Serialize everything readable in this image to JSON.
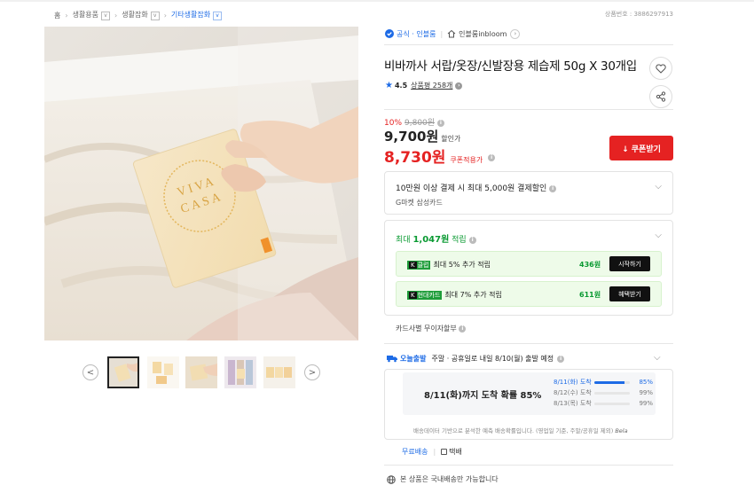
{
  "breadcrumb": {
    "home": "홈",
    "level1": "생활용품",
    "level2": "생활잡화",
    "level3": "기타생활잡화",
    "dropdown_glyph": "v"
  },
  "product_number": "상품번호 : 3886297913",
  "gallery": {
    "image_text_line1": "VIVA",
    "image_text_line2": "CASA",
    "prev_label": "<",
    "next_label": ">"
  },
  "brand": {
    "official_label": "공식 · 인블룸",
    "store_label": "인블룸inbloom"
  },
  "title": "비바까사 서랍/옷장/신발장용 제습제 50g X 30개입",
  "rating": {
    "score": "4.5",
    "review_label": "상품평 258개"
  },
  "price": {
    "discount_rate": "10%",
    "original": "9,800원",
    "sale": "9,700원",
    "sale_suffix": "할인가",
    "coupon_price": "8,730원",
    "coupon_suffix": "쿠폰적용가",
    "coupon_button": "↓ 쿠폰받기"
  },
  "card_promo": {
    "title": "10만원 이상 결제 시 최대 5,000원 결제할인",
    "subtitle": "G마켓 삼성카드"
  },
  "points": {
    "prefix": "최대",
    "amount": "1,047원",
    "suffix": "적립",
    "benefits": [
      {
        "tag": "클럽",
        "tag_prefix": "K",
        "text": "최대 5% 추가 적립",
        "amount": "436원",
        "button": "시작하기"
      },
      {
        "tag": "현대카드",
        "tag_prefix": "K",
        "text": "최대 7% 추가 적립",
        "amount": "611원",
        "button": "혜택받기"
      }
    ]
  },
  "installment": "카드사별 무이자할부",
  "delivery": {
    "badge": "오늘출발",
    "text": "주말 · 공휴일로 내일 8/10(월) 출발 예정",
    "forecast_title": "8/11(화)까지 도착 확률 85%",
    "rows": [
      {
        "label": "8/11(화) 도착",
        "pct": "85%",
        "value": 85,
        "highlight": true
      },
      {
        "label": "8/12(수) 도착",
        "pct": "99%",
        "value": 99,
        "highlight": false
      },
      {
        "label": "8/13(목) 도착",
        "pct": "99%",
        "value": 99,
        "highlight": false
      }
    ],
    "footnote": "배송데이터 기반으로 분석한 예측 배송확률입니다. (영업일 기준, 주말/공휴일 제외)",
    "footnote_brand": "Bela",
    "free_shipping": "무료배송",
    "courier": "택배"
  },
  "domestic_only": "본 상품은 국내배송만 가능합니다",
  "colors": {
    "accent_red": "#e52222",
    "accent_blue": "#1d6be6",
    "accent_green": "#0a9a32"
  }
}
